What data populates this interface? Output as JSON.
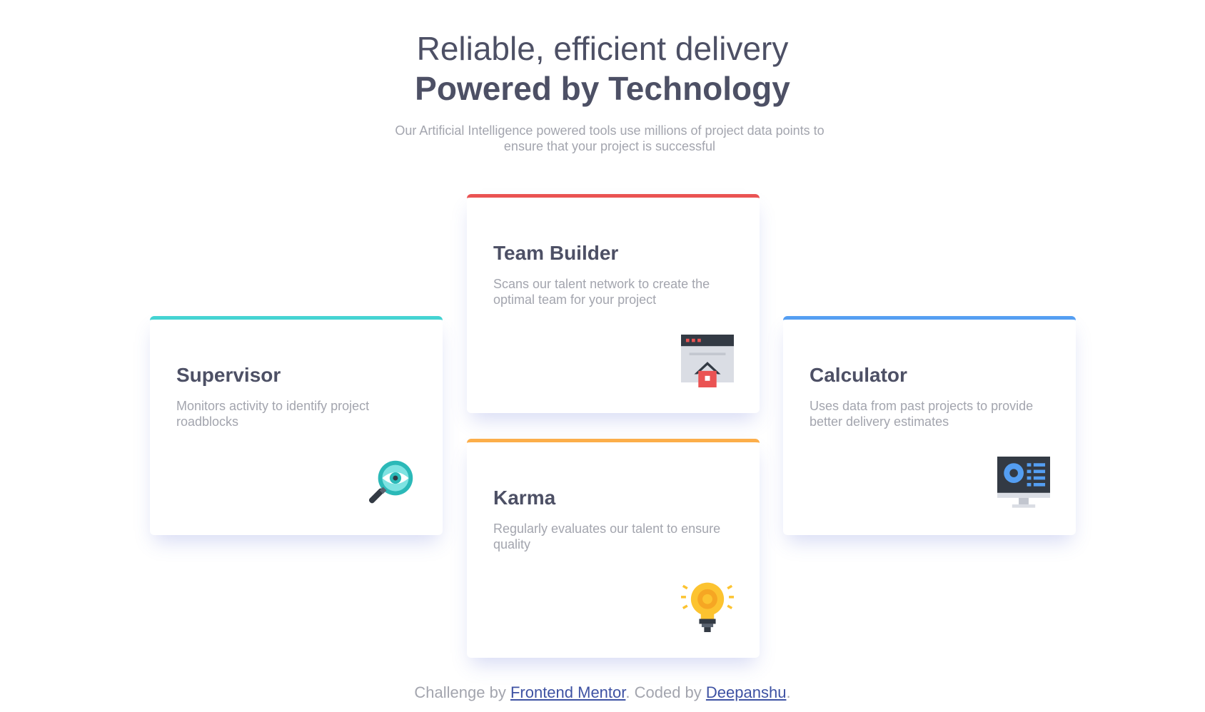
{
  "header": {
    "title_light": "Reliable, efficient delivery",
    "title_bold": "Powered by Technology",
    "subtitle": "Our Artificial Intelligence powered tools use millions of project data points to ensure that your project is successful"
  },
  "cards": [
    {
      "title": "Supervisor",
      "description": "Monitors activity to identify project roadblocks",
      "accent": "#44d3d2",
      "icon": "magnifier-eye-icon"
    },
    {
      "title": "Team Builder",
      "description": "Scans our talent network to create the optimal team for your project",
      "accent": "#ea5353",
      "icon": "browser-house-icon"
    },
    {
      "title": "Karma",
      "description": "Regularly evaluates our talent to ensure quality",
      "accent": "#fcae4a",
      "icon": "lightbulb-icon"
    },
    {
      "title": "Calculator",
      "description": "Uses data from past projects to provide better delivery estimates",
      "accent": "#549ef2",
      "icon": "monitor-chart-icon"
    }
  ],
  "footer": {
    "prefix": "Challenge by ",
    "link1": "Frontend Mentor",
    "middle": ". Coded by ",
    "link2": "Deepanshu",
    "suffix": "."
  }
}
